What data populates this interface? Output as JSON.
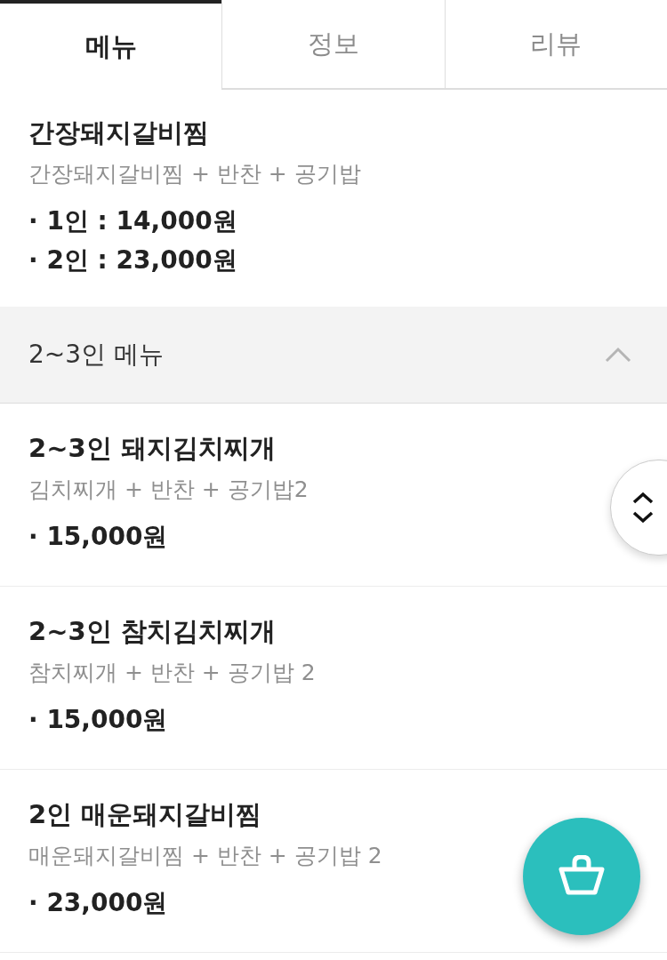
{
  "tabs": [
    {
      "label": "메뉴",
      "selected": true
    },
    {
      "label": "정보",
      "selected": false
    },
    {
      "label": "리뷰",
      "selected": false
    }
  ],
  "items": [
    {
      "name": "간장돼지갈비찜",
      "description": "간장돼지갈비찜 + 반찬 + 공기밥",
      "prices": [
        "· 1인 : 14,000원",
        "· 2인 : 23,000원"
      ]
    }
  ],
  "section": {
    "title": "2~3인 메뉴",
    "expanded": true,
    "items": [
      {
        "name": "2~3인 돼지김치찌개",
        "description": "김치찌개 + 반찬 + 공기밥2",
        "prices": [
          "· 15,000원"
        ]
      },
      {
        "name": "2~3인 참치김치찌개",
        "description": "참치찌개 + 반찬 + 공기밥 2",
        "prices": [
          "· 15,000원"
        ]
      },
      {
        "name": "2인 매운돼지갈비찜",
        "description": "매운돼지갈비찜 + 반찬 + 공기밥 2",
        "prices": [
          "· 23,000원"
        ]
      }
    ]
  }
}
